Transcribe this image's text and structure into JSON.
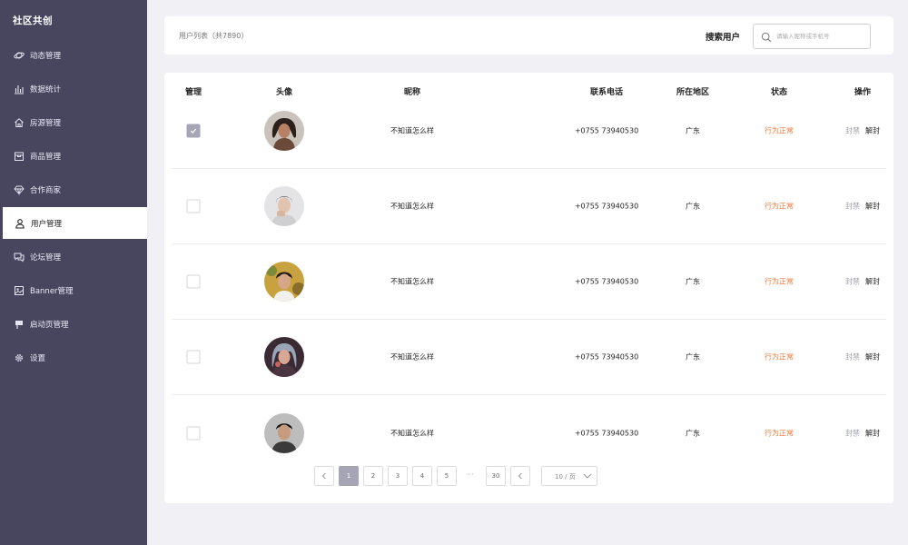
{
  "app": {
    "title": "社区共创"
  },
  "sidebar": {
    "items": [
      {
        "label": "动态管理",
        "icon": "planet-icon"
      },
      {
        "label": "数据统计",
        "icon": "bar-chart-icon"
      },
      {
        "label": "房源管理",
        "icon": "home-icon"
      },
      {
        "label": "商品管理",
        "icon": "box-icon"
      },
      {
        "label": "合作商家",
        "icon": "diamond-icon"
      },
      {
        "label": "用户管理",
        "icon": "user-icon",
        "active": true
      },
      {
        "label": "论坛管理",
        "icon": "chat-icon"
      },
      {
        "label": "Banner管理",
        "icon": "image-icon"
      },
      {
        "label": "启动页管理",
        "icon": "flag-icon"
      },
      {
        "label": "设置",
        "icon": "gear-icon"
      }
    ]
  },
  "header": {
    "title": "用户列表（共7890）",
    "search_label": "搜索用户",
    "search_placeholder": "请输入昵称或手机号"
  },
  "table": {
    "columns": [
      "管理",
      "头像",
      "昵称",
      "联系电话",
      "所在地区",
      "状态",
      "操作"
    ],
    "rows": [
      {
        "checked": true,
        "nickname": "不知道怎么样",
        "phone": "+0755 73940530",
        "region": "广东",
        "status": "行为正常",
        "ban": "封禁",
        "unban": "解封"
      },
      {
        "checked": false,
        "nickname": "不知道怎么样",
        "phone": "+0755 73940530",
        "region": "广东",
        "status": "行为正常",
        "ban": "封禁",
        "unban": "解封"
      },
      {
        "checked": false,
        "nickname": "不知道怎么样",
        "phone": "+0755 73940530",
        "region": "广东",
        "status": "行为正常",
        "ban": "封禁",
        "unban": "解封"
      },
      {
        "checked": false,
        "nickname": "不知道怎么样",
        "phone": "+0755 73940530",
        "region": "广东",
        "status": "行为正常",
        "ban": "封禁",
        "unban": "解封"
      },
      {
        "checked": false,
        "nickname": "不知道怎么样",
        "phone": "+0755 73940530",
        "region": "广东",
        "status": "行为正常",
        "ban": "封禁",
        "unban": "解封"
      }
    ]
  },
  "pagination": {
    "pages": [
      "1",
      "2",
      "3",
      "4",
      "5"
    ],
    "current": "1",
    "ellipsis": "···",
    "last": "30",
    "per_page": "10 / 页"
  },
  "colors": {
    "sidebar_bg": "#48465f",
    "accent": "#a6a5b6",
    "status_ok": "#ef7a3b"
  }
}
